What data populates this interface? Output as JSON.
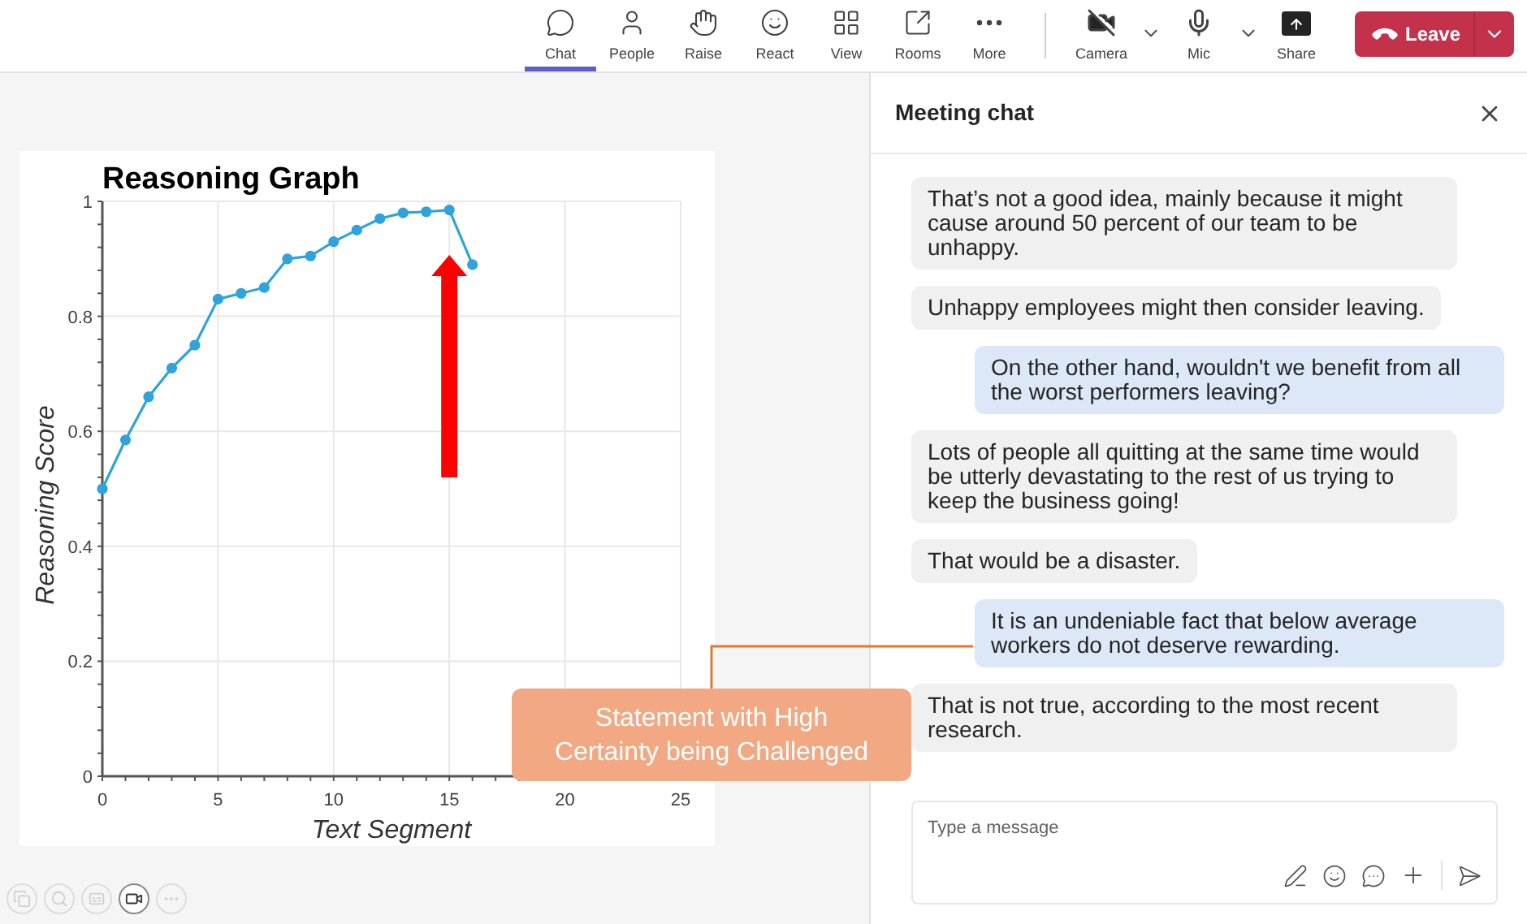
{
  "toolbar": {
    "items": [
      {
        "label": "Chat",
        "selected": true
      },
      {
        "label": "People",
        "selected": false
      },
      {
        "label": "Raise",
        "selected": false
      },
      {
        "label": "React",
        "selected": false
      },
      {
        "label": "View",
        "selected": false
      },
      {
        "label": "Rooms",
        "selected": false
      },
      {
        "label": "More",
        "selected": false
      }
    ],
    "devices": [
      {
        "label": "Camera",
        "kind": "split"
      },
      {
        "label": "Mic",
        "kind": "split"
      },
      {
        "label": "Share",
        "kind": "plain"
      }
    ],
    "leave_button": "Leave"
  },
  "chart": {
    "chart_data": {
      "type": "line",
      "title": "Reasoning Graph",
      "xlabel": "Text Segment",
      "ylabel": "Reasoning Score",
      "x": [
        0,
        1,
        2,
        3,
        4,
        5,
        6,
        7,
        8,
        9,
        10,
        11,
        12,
        13,
        14,
        15,
        16
      ],
      "series": [
        {
          "color": "#2ea3dc",
          "marker": true,
          "values": [
            0.5,
            0.585,
            0.66,
            0.71,
            0.75,
            0.83,
            0.84,
            0.85,
            0.9,
            0.905,
            0.93,
            0.95,
            0.97,
            0.98,
            0.982,
            0.985,
            0.89
          ]
        }
      ],
      "grid": true,
      "xlim": [
        0,
        25
      ],
      "ylim": [
        0,
        1
      ],
      "xticks": [
        0,
        5,
        10,
        15,
        20,
        25
      ],
      "yticks": [
        {
          "value": 0,
          "label": "0"
        },
        {
          "value": 0.2,
          "label": "0.2"
        },
        {
          "value": 0.4,
          "label": "0.4"
        },
        {
          "value": 0.6,
          "label": "0.6"
        },
        {
          "value": 0.8,
          "label": "0.8"
        },
        {
          "value": 1,
          "label": "1"
        }
      ]
    }
  },
  "callout": "Statement with High Certainty being Challenged",
  "bottom_controls": [
    {
      "disabled": true
    },
    {
      "disabled": true
    },
    {
      "disabled": true
    },
    {
      "disabled": false
    },
    {
      "disabled": true
    }
  ],
  "chat": {
    "title": "Meeting chat",
    "messages": [
      {
        "kind": "received",
        "text": "That’s not a good idea, mainly because it might cause around 50 percent of our team to be unhappy."
      },
      {
        "kind": "received",
        "text": "Unhappy employees might then consider leaving."
      },
      {
        "kind": "sent",
        "text": "On the other hand, wouldn't we benefit from all the worst performers leaving?"
      },
      {
        "kind": "received",
        "text": "Lots of people all quitting at the same time would be utterly devastating to the rest of us trying to keep the business going!"
      },
      {
        "kind": "received",
        "text": "That would be a disaster."
      },
      {
        "kind": "sent",
        "text": "It is an undeniable fact that below average workers do not deserve rewarding."
      },
      {
        "kind": "received",
        "text": "That is not true, according to the most recent research."
      }
    ],
    "composer": {
      "placeholder": "Type a message"
    }
  }
}
